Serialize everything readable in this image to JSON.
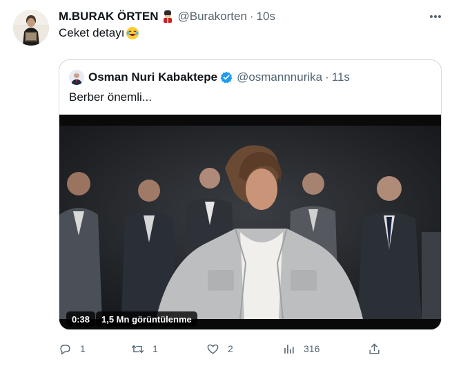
{
  "tweet": {
    "author_name": "M.BURAK ÖRTEN",
    "author_emoji": "guard-emoji",
    "handle": "@Burakorten",
    "separator": "·",
    "time": "10s",
    "text": "Ceket detayı",
    "text_emoji": "laughing-emoji"
  },
  "quote": {
    "author_name": "Osman Nuri Kabaktepe",
    "verified": "verified-badge-icon",
    "handle": "@osmannnurika",
    "separator": "·",
    "time": "11s",
    "text": "Berber önemli...",
    "video": {
      "duration": "0:38",
      "views": "1,5 Mn görüntülenme"
    }
  },
  "actions": {
    "reply": {
      "icon": "reply-icon",
      "count": "1"
    },
    "retweet": {
      "icon": "retweet-icon",
      "count": "1"
    },
    "like": {
      "icon": "heart-icon",
      "count": "2"
    },
    "views": {
      "icon": "analytics-icon",
      "count": "316"
    },
    "share": {
      "icon": "share-icon"
    }
  },
  "colors": {
    "text": "#0f1419",
    "secondary": "#536471",
    "border": "#cfd9de",
    "verified": "#1d9bf0"
  }
}
